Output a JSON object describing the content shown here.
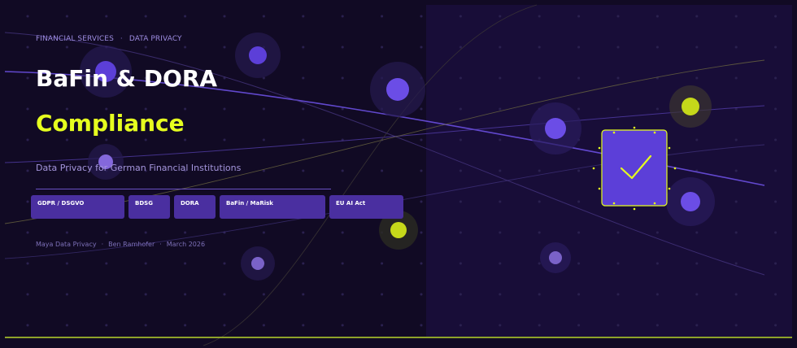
{
  "eyebrow": {
    "left": "FINANCIAL SERVICES",
    "separator": "·",
    "right": "DATA PRIVACY"
  },
  "title": "BaFin & DORA",
  "title_accent": "Compliance",
  "subtitle": "Data Privacy for German Financial Institutions",
  "tags": [
    "GDPR / DSGVO",
    "BDSG",
    "DORA",
    "BaFin / MaRisk",
    "EU AI Act"
  ],
  "footer": {
    "company": "Maya Data Privacy",
    "author": "Ben Ramhofer",
    "date": "March 2026",
    "separator": "·"
  },
  "colors": {
    "background": "#110a24",
    "accent_yellow": "#e6ff1f",
    "accent_purple": "#6b4de6",
    "tag_background": "#4a2fa0",
    "text_muted": "#a596dd"
  },
  "icons": {
    "badge": "shield-check-icon"
  }
}
